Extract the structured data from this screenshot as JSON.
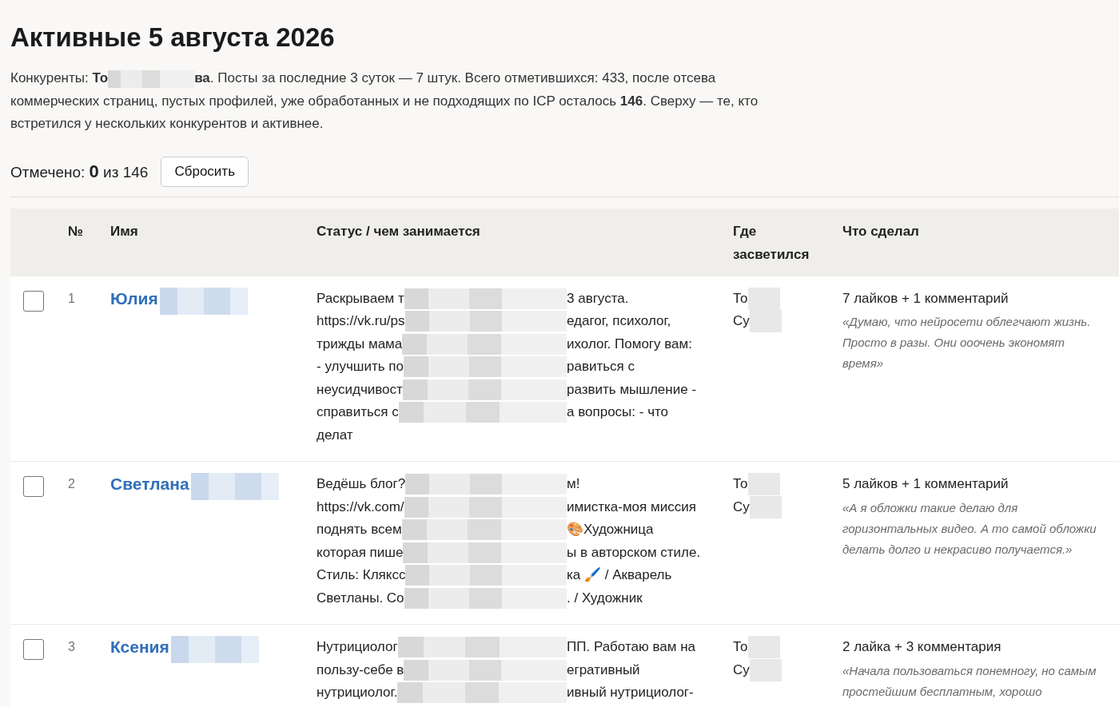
{
  "title": "Активные 5 августа 2026",
  "intro": {
    "before": "Конкуренты: **То**",
    "after": "**ва**. Посты за последние 3 суток — 7 штук. Всего отметившихся: 433, после отсева коммерческих страниц, пустых профилей, уже обработанных и не подходящих по ICP осталось **146**. Сверху — те, кто встретился у нескольких конкурентов и активнее."
  },
  "counter": {
    "label": "Отмечено:",
    "count": "0",
    "total": "из 146"
  },
  "reset_button": "Сбросить",
  "table": {
    "columns": [
      "№",
      "Имя",
      "Статус / чем занимается",
      "Где засветился",
      "Что сделал"
    ],
    "rows": [
      {
        "checked": false,
        "number": "1",
        "name": "Юлия",
        "status": [
          {
            "kind": "cut",
            "text": "Раскрываем т",
            "rest": "3 августа."
          },
          {
            "kind": "cut",
            "text": "https://vk.ru/ps",
            "rest": "едагог, психолог,"
          },
          {
            "kind": "cut",
            "text": "трижды мама",
            "rest": "ихолог. Помогу вам:"
          },
          {
            "kind": "cut",
            "text": "- улучшить по",
            "rest": "равиться с"
          },
          {
            "kind": "cut",
            "text": "неусидчивост",
            "rest": "развить мышление -"
          },
          {
            "kind": "cut",
            "text": "справиться с",
            "rest": "а вопросы: - что"
          },
          {
            "kind": "plain",
            "text": "делат"
          }
        ],
        "where": [
          {
            "kind": "cut",
            "text": "То"
          },
          {
            "kind": "cut",
            "text": "Су"
          }
        ],
        "action": "7 лайков + 1 комментарий",
        "quote": "«Думаю, что нейросети облегчают жизнь. Просто в разы. Они ооочень экономят время»"
      },
      {
        "checked": false,
        "number": "2",
        "name": "Светлана",
        "status": [
          {
            "kind": "cut",
            "text": "Ведёшь блог?",
            "rest": "м!"
          },
          {
            "kind": "cut",
            "text": "https://vk.com/",
            "rest": "имистка-моя миссия"
          },
          {
            "kind": "cut",
            "text": "поднять всем",
            "rest": "🎨Художница"
          },
          {
            "kind": "cut",
            "text": "которая пише",
            "rest": "ы в авторском стиле."
          },
          {
            "kind": "cut",
            "text": "Стиль: Кляксс",
            "rest": "ка 🖌️ / Акварель"
          },
          {
            "kind": "cut",
            "text": "Светланы. Со",
            "rest": ". / Художник"
          }
        ],
        "where": [
          {
            "kind": "cut",
            "text": "То"
          },
          {
            "kind": "cut",
            "text": "Су"
          }
        ],
        "action": "5 лайков + 1 комментарий",
        "quote": "«А я обложки такие делаю для горизонтальных видео. А то самой обложки делать долго и некрасиво получается.»"
      },
      {
        "checked": false,
        "number": "3",
        "name": "Ксения",
        "status": [
          {
            "kind": "cut",
            "text": "Нутрициолог",
            "rest": "ПП. Работаю вам на"
          },
          {
            "kind": "cut",
            "text": "пользу-себе в",
            "rest": "егративный"
          },
          {
            "kind": "cut",
            "text": "нутрициолог.",
            "rest": "ивный нутрициолог-"
          }
        ],
        "where": [
          {
            "kind": "cut",
            "text": "То"
          },
          {
            "kind": "cut",
            "text": "Су"
          }
        ],
        "action": "2 лайка + 3 комментария",
        "quote": "«Начала пользоваться понемногу, но самым простейшим бесплатным, хорошо"
      }
    ]
  }
}
